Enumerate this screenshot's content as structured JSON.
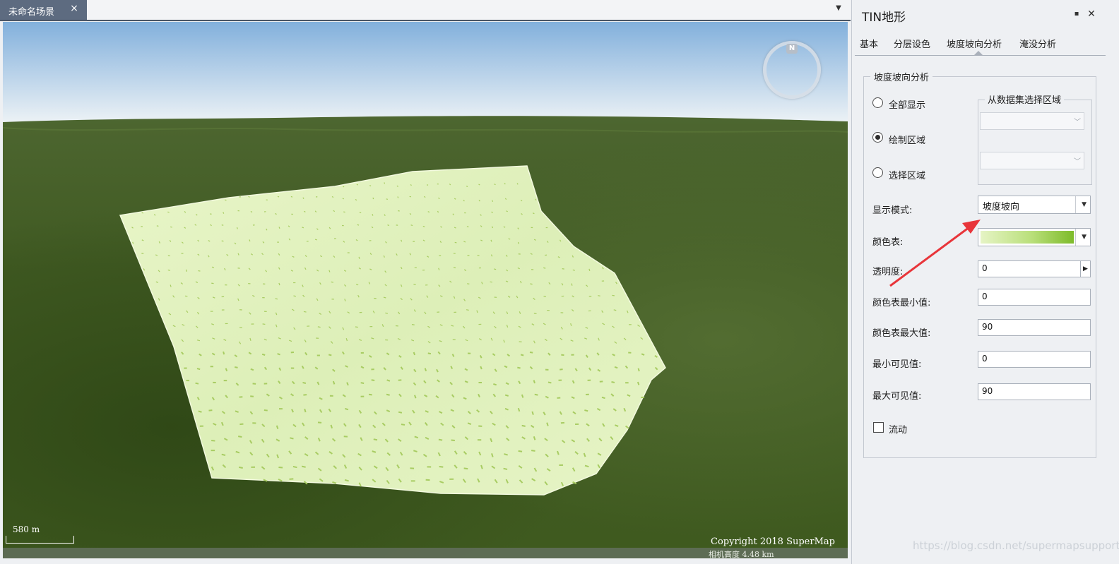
{
  "document_tab": {
    "label": "未命名场景",
    "close_glyph": "×"
  },
  "scene": {
    "compass_label": "N",
    "scale_label": "580 m",
    "copyright": "Copyright 2018 SuperMap",
    "camera_height": "相机高度 4.48 km",
    "colors": {
      "sky_top": "#87b3dd",
      "sky_bottom": "#e8f0f5",
      "terrain": "#3d5720",
      "overlay": "#e4f3c2",
      "arrow_marks": "#a8cc62"
    }
  },
  "panel": {
    "title": "TIN地形",
    "tabs": [
      "基本",
      "分层设色",
      "坡度坡向分析",
      "淹没分析"
    ],
    "active_tab": "坡度坡向分析",
    "group_title": "坡度坡向分析",
    "region_options": [
      {
        "label": "全部显示",
        "checked": false
      },
      {
        "label": "绘制区域",
        "checked": true
      },
      {
        "label": "选择区域",
        "checked": false
      }
    ],
    "dataset_group_title": "从数据集选择区域",
    "display_mode_label": "显示模式:",
    "display_mode_value": "坡度坡向",
    "color_table_label": "颜色表:",
    "transparency_label": "透明度:",
    "transparency_value": "0",
    "color_min_label": "颜色表最小值:",
    "color_min_value": "0",
    "color_max_label": "颜色表最大值:",
    "color_max_value": "90",
    "visible_min_label": "最小可见值:",
    "visible_min_value": "0",
    "visible_max_label": "最大可见值:",
    "visible_max_value": "90",
    "flow_label": "流动",
    "flow_checked": false
  },
  "watermark": "https://blog.csdn.net/supermapsupport",
  "annotation_color": "#e8353a"
}
